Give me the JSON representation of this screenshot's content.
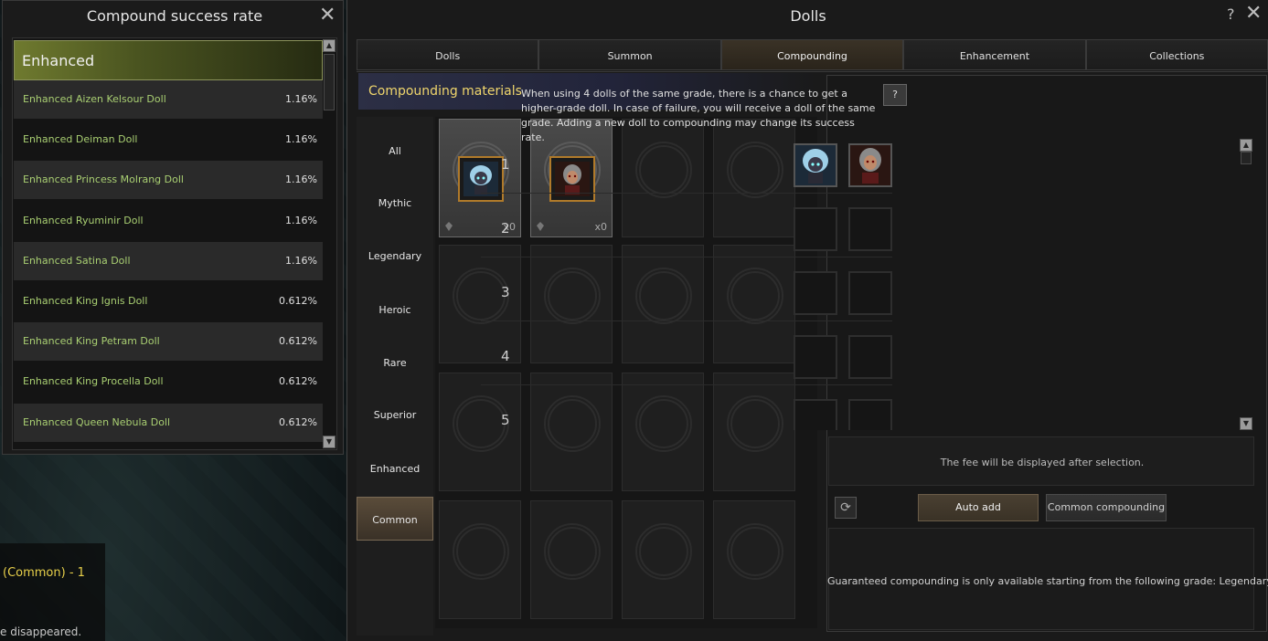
{
  "background": {
    "chat_line1": "(Common) - 1",
    "chat_line2": "e disappeared."
  },
  "rate_panel": {
    "title": "Compound success rate",
    "header": "Enhanced",
    "rows": [
      {
        "name": "Enhanced Aizen Kelsour Doll",
        "rate": "1.16%"
      },
      {
        "name": "Enhanced Deiman Doll",
        "rate": "1.16%"
      },
      {
        "name": "Enhanced Princess Molrang Doll",
        "rate": "1.16%"
      },
      {
        "name": "Enhanced Ryuminir Doll",
        "rate": "1.16%"
      },
      {
        "name": "Enhanced Satina Doll",
        "rate": "1.16%"
      },
      {
        "name": "Enhanced King Ignis Doll",
        "rate": "0.612%"
      },
      {
        "name": "Enhanced King Petram Doll",
        "rate": "0.612%"
      },
      {
        "name": "Enhanced King Procella Doll",
        "rate": "0.612%"
      },
      {
        "name": "Enhanced Queen Nebula Doll",
        "rate": "0.612%"
      }
    ]
  },
  "window": {
    "title": "Dolls",
    "help": "?",
    "tabs": [
      "Dolls",
      "Summon",
      "Compounding",
      "Enhancement",
      "Collections"
    ],
    "active_tab": "Compounding"
  },
  "materials": {
    "header": "Compounding materials",
    "categories": [
      "All",
      "Mythic",
      "Legendary",
      "Heroic",
      "Rare",
      "Superior",
      "Enhanced",
      "Common"
    ],
    "active_category": "Common",
    "items": [
      {
        "count": "x0",
        "doll": "blue-haired-doll"
      },
      {
        "count": "x0",
        "doll": "dark-elf-doll"
      }
    ]
  },
  "compounding": {
    "info": "When using 4 dolls of the same grade, there is a chance to get a higher-grade doll. In case of failure, you will receive a doll of the same grade. Adding a new doll to compounding may change its success rate.",
    "row_numbers": [
      "1",
      "2",
      "3",
      "4",
      "5"
    ],
    "fee_text": "The fee will be displayed after selection.",
    "auto_add": "Auto add",
    "common_compounding": "Common compounding",
    "guaranteed_text": "Guaranteed compounding is only available starting from the following grade: Legendary, Heroic."
  }
}
